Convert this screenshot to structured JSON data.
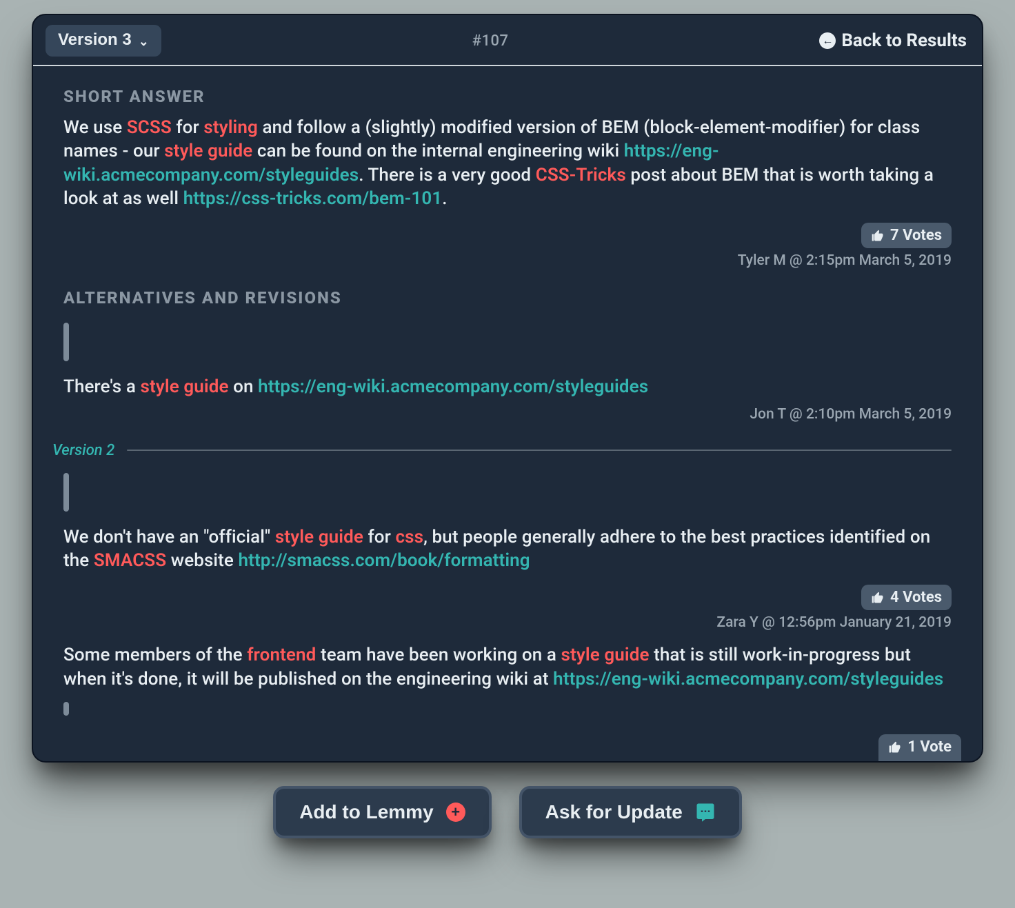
{
  "header": {
    "version_label": "Version 3",
    "id_label": "#107",
    "back_label": "Back to Results"
  },
  "short_answer": {
    "title": "SHORT ANSWER",
    "segments": [
      {
        "t": "plain",
        "v": "We use "
      },
      {
        "t": "red",
        "v": "SCSS"
      },
      {
        "t": "plain",
        "v": " for "
      },
      {
        "t": "red",
        "v": "styling"
      },
      {
        "t": "plain",
        "v": " and follow a (slightly) modified version of BEM (block-element-modifier) for class names - our "
      },
      {
        "t": "red",
        "v": "style guide"
      },
      {
        "t": "plain",
        "v": " can be found on the internal engineering wiki "
      },
      {
        "t": "teal",
        "v": "https://eng-wiki.acmecompany.com/styleguides"
      },
      {
        "t": "plain",
        "v": ". There is a very good "
      },
      {
        "t": "red",
        "v": "CSS-Tricks"
      },
      {
        "t": "plain",
        "v": " post about BEM that is worth taking a look at as well "
      },
      {
        "t": "teal",
        "v": "https://css-tricks.com/bem-101"
      },
      {
        "t": "plain",
        "v": "."
      }
    ],
    "votes_label": "7 Votes",
    "meta": "Tyler M @ 2:15pm March 5, 2019"
  },
  "alternatives": {
    "title": "ALTERNATIVES AND REVISIONS",
    "revisions": [
      {
        "segments": [
          {
            "t": "plain",
            "v": "There's a "
          },
          {
            "t": "red",
            "v": "style guide"
          },
          {
            "t": "plain",
            "v": " on "
          },
          {
            "t": "teal",
            "v": "https://eng-wiki.acmecompany.com/styleguides"
          }
        ],
        "meta": "Jon T @ 2:10pm March 5, 2019"
      },
      {
        "version_divider": "Version 2",
        "segments": [
          {
            "t": "plain",
            "v": "We don't have an \"official\" "
          },
          {
            "t": "red",
            "v": "style guide"
          },
          {
            "t": "plain",
            "v": " for "
          },
          {
            "t": "red",
            "v": "css"
          },
          {
            "t": "plain",
            "v": ", but people generally adhere to the best practices identified on the "
          },
          {
            "t": "red",
            "v": "SMACSS"
          },
          {
            "t": "plain",
            "v": " website "
          },
          {
            "t": "teal",
            "v": "http://smacss.com/book/formatting"
          }
        ],
        "votes_label": "4 Votes",
        "meta": "Zara Y @ 12:56pm January 21, 2019"
      },
      {
        "segments": [
          {
            "t": "plain",
            "v": "Some members of the "
          },
          {
            "t": "red",
            "v": "frontend"
          },
          {
            "t": "plain",
            "v": " team have been working on a "
          },
          {
            "t": "red",
            "v": "style guide"
          },
          {
            "t": "plain",
            "v": " that is still work-in-progress but when it's done, it will be published on the engineering wiki at "
          },
          {
            "t": "teal",
            "v": "https://eng-wiki.acmecompany.com/styleguides"
          }
        ]
      }
    ],
    "peek_vote": "1 Vote"
  },
  "actions": {
    "add_label": "Add to Lemmy",
    "update_label": "Ask for Update"
  }
}
